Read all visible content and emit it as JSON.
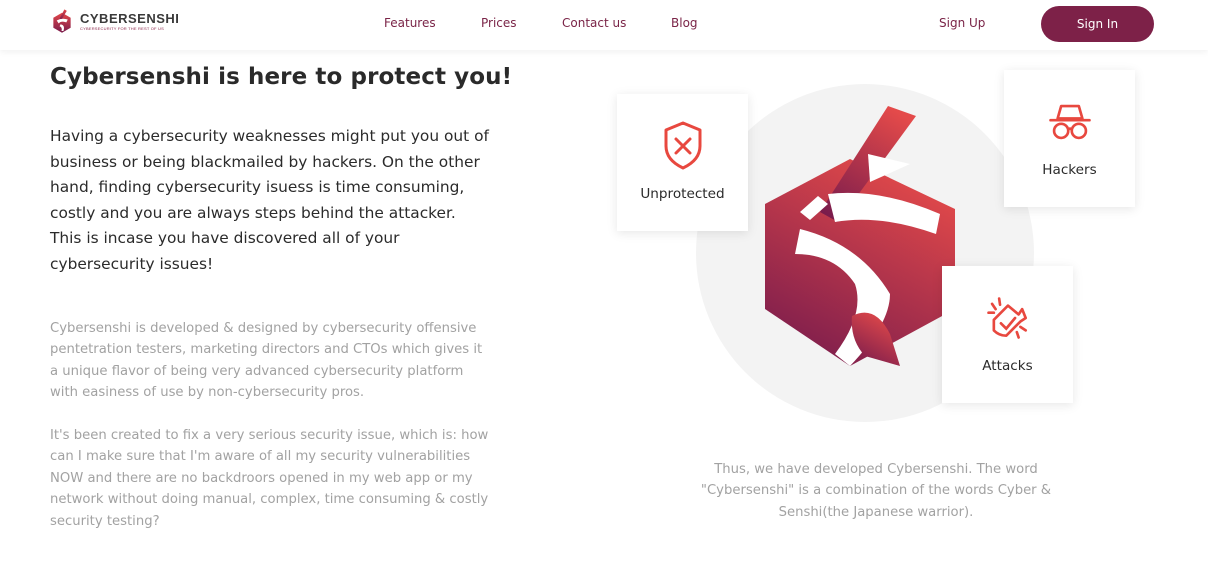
{
  "brand": {
    "name": "CYBERSENSHI",
    "tagline": "CYBERSECURITY FOR THE REST OF US",
    "accent": "#7d2148",
    "gradient_start": "#e4474a",
    "gradient_end": "#7a1c4c"
  },
  "nav": {
    "links": [
      "Features",
      "Prices",
      "Contact us",
      "Blog"
    ],
    "signup": "Sign Up",
    "signin": "Sign In"
  },
  "main": {
    "title": "Cybersenshi is here to protect you!",
    "lead": "Having a cybersecurity weaknesses might put you out of business or being blackmailed by hackers. On the other hand, finding cybersecurity isuess is time consuming, costly and you are always steps behind the attacker. This is incase you have discovered all of your cybersecurity issues!",
    "paragraph1": "Cybersenshi is developed & designed by cybersecurity offensive pentetration testers, marketing directors and CTOs which gives it a unique flavor of being very advanced cybersecurity platform with easiness of use by non-cybersecurity pros.",
    "paragraph2": "It's been created to fix a very serious security issue, which is: how can I make sure that I'm aware of all my security vulnerabilities NOW and there are no backdroors opened in my web app or my network without doing manual, complex, time consuming & costly security testing?"
  },
  "illustration": {
    "cards": [
      {
        "label": "Unprotected",
        "icon": "shield-x-icon"
      },
      {
        "label": "Hackers",
        "icon": "hacker-spy-icon"
      },
      {
        "label": "Attacks",
        "icon": "explosion-attack-icon"
      }
    ],
    "icon_color": "#e8483f",
    "caption": "Thus, we have developed Cybersenshi. The word \"Cybersenshi\" is a combination of the words Cyber & Senshi(the Japanese warrior)."
  }
}
